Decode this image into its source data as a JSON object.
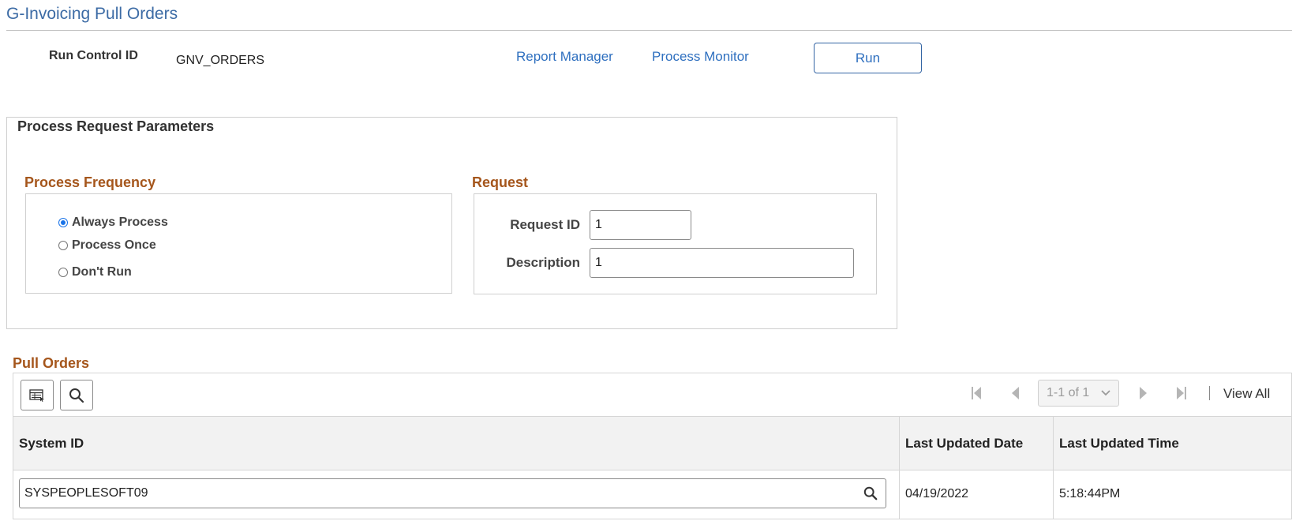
{
  "page": {
    "title": "G-Invoicing Pull Orders"
  },
  "run_control": {
    "label": "Run Control ID",
    "value": "GNV_ORDERS",
    "report_manager_link": "Report Manager",
    "process_monitor_link": "Process Monitor",
    "run_button": "Run"
  },
  "process_request": {
    "title": "Process Request Parameters",
    "frequency": {
      "title": "Process Frequency",
      "options": [
        {
          "label": "Always Process",
          "checked": true
        },
        {
          "label": "Process Once",
          "checked": false
        },
        {
          "label": "Don't Run",
          "checked": false
        }
      ]
    },
    "request": {
      "title": "Request",
      "request_id_label": "Request ID",
      "request_id_value": "1",
      "description_label": "Description",
      "description_value": "1"
    }
  },
  "pull_orders": {
    "title": "Pull Orders",
    "pager": {
      "range": "1-1 of 1",
      "view_all": "View All"
    },
    "columns": [
      "System ID",
      "Last Updated Date",
      "Last Updated Time"
    ],
    "rows": [
      {
        "system_id": "SYSPEOPLESOFT09",
        "last_updated_date": "04/19/2022",
        "last_updated_time": "5:18:44PM"
      }
    ]
  },
  "icons": {
    "grid_personalize": "grid-personalize-icon",
    "search": "search-icon",
    "first": "first-page-icon",
    "previous": "previous-page-icon",
    "next": "next-page-icon",
    "last": "last-page-icon",
    "dropdown": "chevron-down-icon"
  },
  "colors": {
    "title_blue": "#3c6ba5",
    "link_blue": "#2e6fbf",
    "section_orange": "#a5561c",
    "radio_checked": "#1a73e8"
  }
}
